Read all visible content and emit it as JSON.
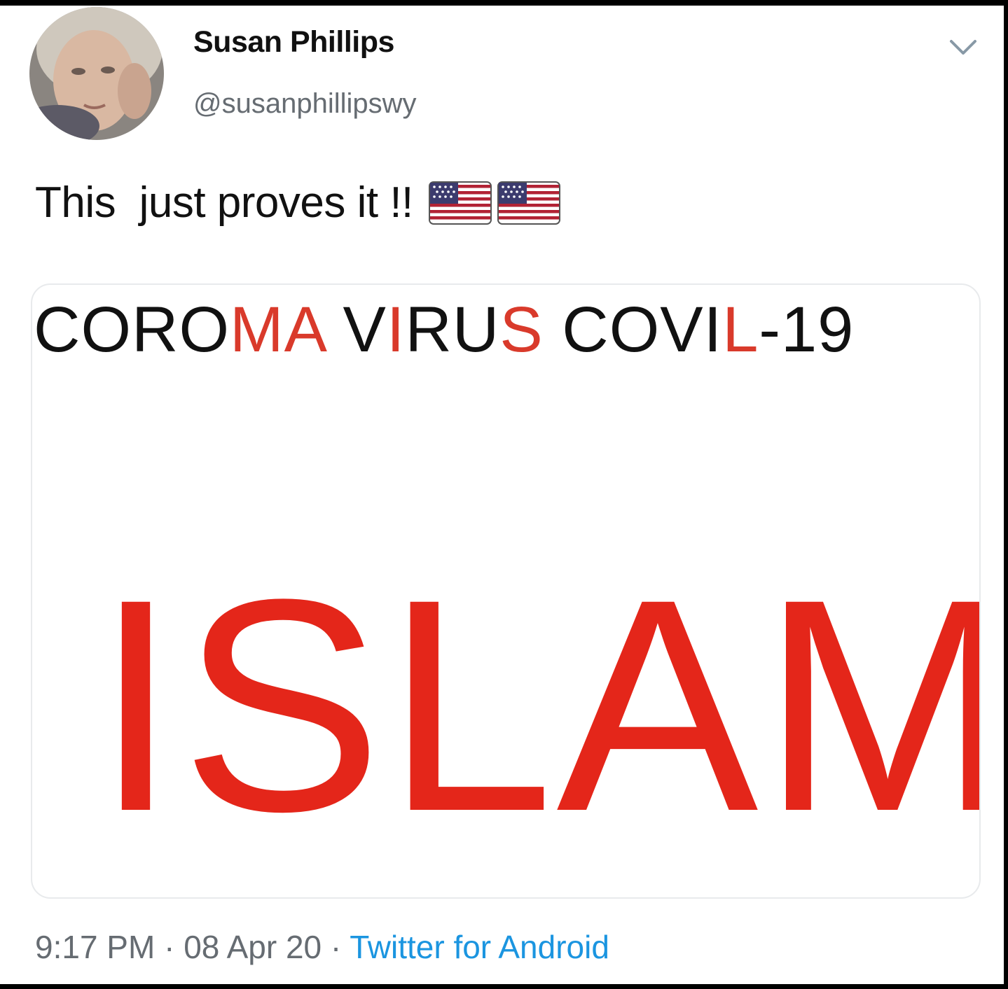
{
  "user": {
    "display_name": "Susan Phillips",
    "handle": "@susanphillipswy"
  },
  "tweet": {
    "text": "This  just proves it !!",
    "emoji": [
      "us-flag",
      "us-flag"
    ]
  },
  "card": {
    "headline_parts": [
      {
        "text": "CORO",
        "color": "black"
      },
      {
        "text": "MA",
        "color": "red"
      },
      {
        "text": " V",
        "color": "black"
      },
      {
        "text": "I",
        "color": "red"
      },
      {
        "text": "RU",
        "color": "black"
      },
      {
        "text": "S",
        "color": "red"
      },
      {
        "text": " COVI",
        "color": "black"
      },
      {
        "text": "L",
        "color": "red"
      },
      {
        "text": "-19",
        "color": "black"
      }
    ],
    "big_word": "ISLAM"
  },
  "meta": {
    "time": "9:17 PM",
    "sep1": " · ",
    "date": "08 Apr 20",
    "sep2": " · ",
    "source": "Twitter for Android"
  },
  "colors": {
    "accent_red": "#e4261a",
    "link_blue": "#1b95e0",
    "muted_gray": "#666c72"
  },
  "icons": {
    "menu": "chevron-down-icon"
  }
}
